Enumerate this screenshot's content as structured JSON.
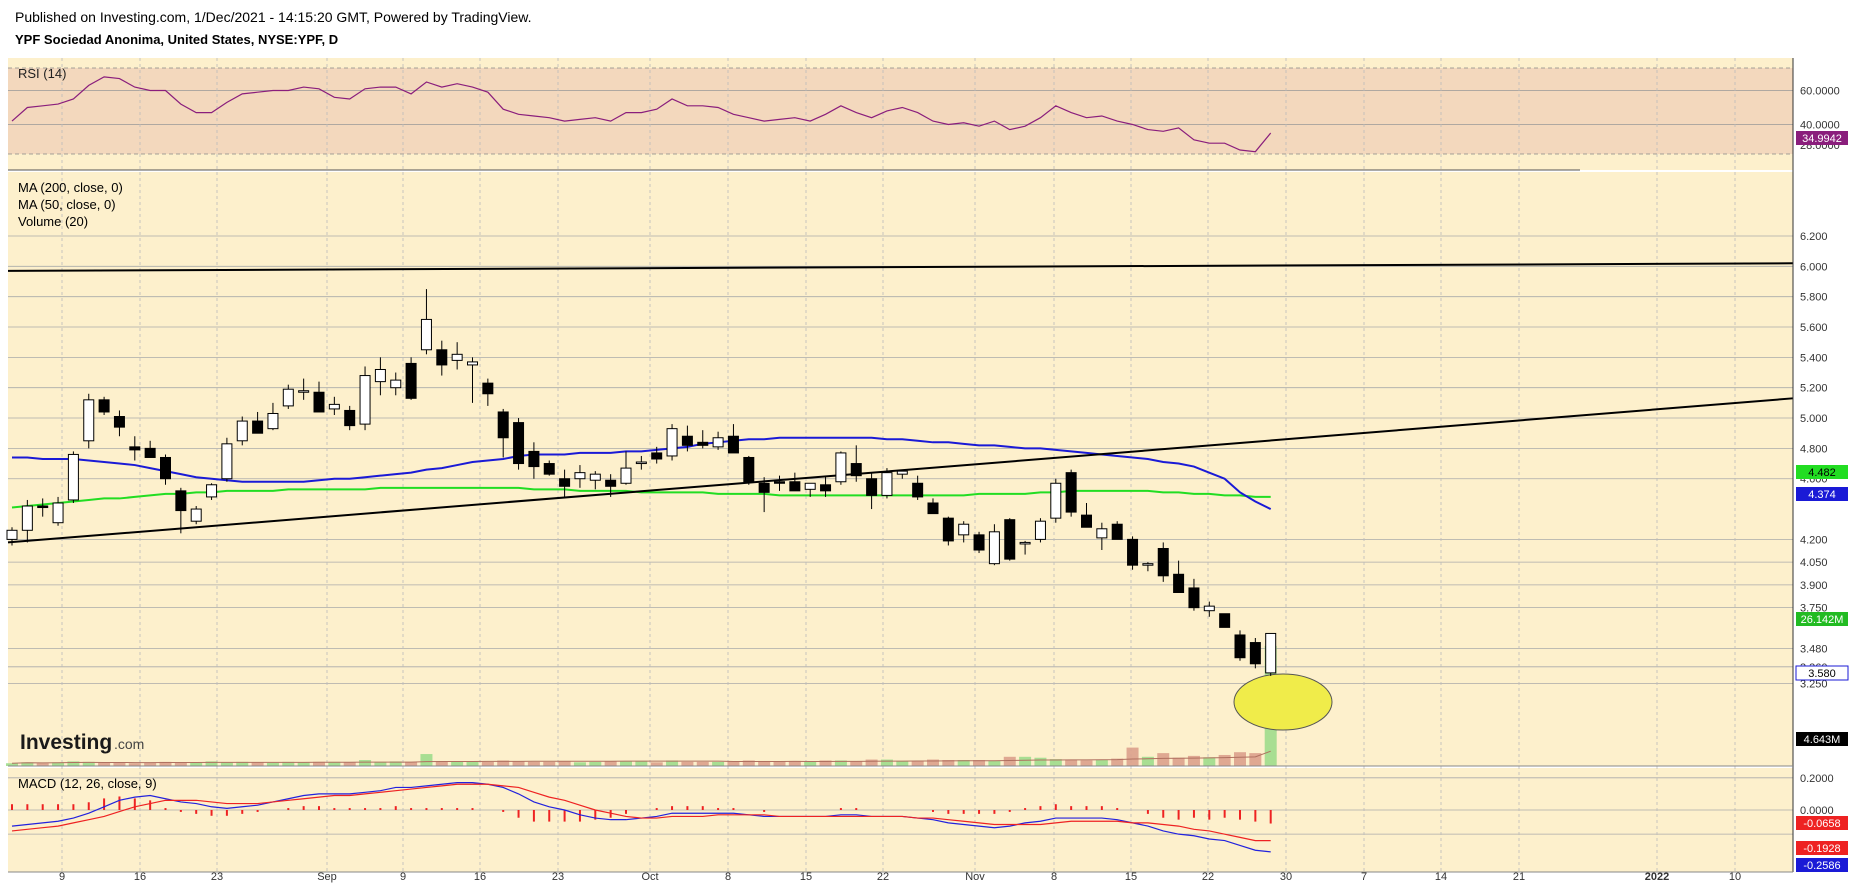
{
  "header": {
    "published": "Published on Investing.com, 1/Dec/2021 - 14:15:20 GMT, Powered by TradingView.",
    "symbol": "YPF Sociedad Anonima, United States, NYSE:YPF, D"
  },
  "colors": {
    "pane_bg": "#fdf0cc",
    "rsi_band": "#f3d8bd",
    "rsi_line": "#8a1e7c",
    "ma200": "#22dd22",
    "ma50": "#1a1ad6",
    "bull_vol": "#9fdc8c",
    "bear_vol": "#dca08c",
    "macd_line": "#2222dd",
    "signal_line": "#ee2222",
    "hist": "#ee2222",
    "highlight": "#f0ec4a"
  },
  "rsi_pane": {
    "label": "RSI (14)",
    "ticks": [
      "60.0000",
      "40.0000",
      "28.0000"
    ],
    "last_value": "34.9942"
  },
  "price_pane": {
    "legend": [
      "MA (200, close, 0)",
      "MA (50, close, 0)",
      "Volume (20)"
    ],
    "ticks": [
      "6.200",
      "6.000",
      "5.800",
      "5.600",
      "5.400",
      "5.200",
      "5.000",
      "4.800",
      "4.600",
      "4.200",
      "4.050",
      "3.900",
      "3.750",
      "3.480",
      "3.360",
      "3.250"
    ],
    "ma200_label": "4.482",
    "ma50_label": "4.374",
    "volume_label": "26.142M",
    "price_label": "3.580",
    "volume_ma_label": "4.643M",
    "watermark": "Investing",
    "watermark_suffix": ".com"
  },
  "macd_pane": {
    "label": "MACD (12, 26, close, 9)",
    "ticks": [
      "0.2000",
      "0.0000"
    ],
    "hist_label": "-0.0658",
    "signal_label": "-0.1928",
    "macd_label": "-0.2586"
  },
  "x_axis": {
    "labels": [
      "9",
      "16",
      "23",
      "Sep",
      "9",
      "16",
      "23",
      "Oct",
      "8",
      "15",
      "22",
      "Nov",
      "8",
      "15",
      "22",
      "30",
      "7",
      "14",
      "21",
      "2022",
      "10"
    ]
  },
  "chart_data": {
    "type": "candlestick",
    "title": "YPF Sociedad Anonima, United States, NYSE:YPF, D",
    "candles": [
      {
        "o": 4.2,
        "h": 4.28,
        "l": 4.16,
        "c": 4.26
      },
      {
        "o": 4.26,
        "h": 4.46,
        "l": 4.18,
        "c": 4.42
      },
      {
        "o": 4.42,
        "h": 4.47,
        "l": 4.35,
        "c": 4.41
      },
      {
        "o": 4.31,
        "h": 4.48,
        "l": 4.29,
        "c": 4.44
      },
      {
        "o": 4.46,
        "h": 4.78,
        "l": 4.44,
        "c": 4.76
      },
      {
        "o": 4.85,
        "h": 5.16,
        "l": 4.8,
        "c": 5.12
      },
      {
        "o": 5.12,
        "h": 5.14,
        "l": 5.02,
        "c": 5.04
      },
      {
        "o": 5.01,
        "h": 5.05,
        "l": 4.88,
        "c": 4.94
      },
      {
        "o": 4.81,
        "h": 4.88,
        "l": 4.72,
        "c": 4.79
      },
      {
        "o": 4.8,
        "h": 4.85,
        "l": 4.76,
        "c": 4.74
      },
      {
        "o": 4.74,
        "h": 4.76,
        "l": 4.56,
        "c": 4.6
      },
      {
        "o": 4.52,
        "h": 4.54,
        "l": 4.24,
        "c": 4.39
      },
      {
        "o": 4.32,
        "h": 4.42,
        "l": 4.3,
        "c": 4.4
      },
      {
        "o": 4.48,
        "h": 4.57,
        "l": 4.46,
        "c": 4.56
      },
      {
        "o": 4.6,
        "h": 4.87,
        "l": 4.58,
        "c": 4.83
      },
      {
        "o": 4.85,
        "h": 5.01,
        "l": 4.82,
        "c": 4.98
      },
      {
        "o": 4.98,
        "h": 5.04,
        "l": 4.9,
        "c": 4.9
      },
      {
        "o": 4.93,
        "h": 5.1,
        "l": 4.92,
        "c": 5.03
      },
      {
        "o": 5.08,
        "h": 5.22,
        "l": 5.06,
        "c": 5.19
      },
      {
        "o": 5.18,
        "h": 5.26,
        "l": 5.12,
        "c": 5.18
      },
      {
        "o": 5.17,
        "h": 5.24,
        "l": 5.04,
        "c": 5.04
      },
      {
        "o": 5.06,
        "h": 5.14,
        "l": 5.02,
        "c": 5.09
      },
      {
        "o": 5.05,
        "h": 5.08,
        "l": 4.92,
        "c": 4.95
      },
      {
        "o": 4.96,
        "h": 5.34,
        "l": 4.92,
        "c": 5.28
      },
      {
        "o": 5.24,
        "h": 5.4,
        "l": 5.15,
        "c": 5.32
      },
      {
        "o": 5.2,
        "h": 5.3,
        "l": 5.15,
        "c": 5.25
      },
      {
        "o": 5.36,
        "h": 5.4,
        "l": 5.12,
        "c": 5.13
      },
      {
        "o": 5.45,
        "h": 5.85,
        "l": 5.42,
        "c": 5.65
      },
      {
        "o": 5.45,
        "h": 5.51,
        "l": 5.28,
        "c": 5.35
      },
      {
        "o": 5.38,
        "h": 5.5,
        "l": 5.32,
        "c": 5.42
      },
      {
        "o": 5.35,
        "h": 5.4,
        "l": 5.1,
        "c": 5.37
      },
      {
        "o": 5.23,
        "h": 5.26,
        "l": 5.08,
        "c": 5.16
      },
      {
        "o": 5.04,
        "h": 5.06,
        "l": 4.74,
        "c": 4.87
      },
      {
        "o": 4.97,
        "h": 5.0,
        "l": 4.66,
        "c": 4.7
      },
      {
        "o": 4.78,
        "h": 4.84,
        "l": 4.6,
        "c": 4.68
      },
      {
        "o": 4.7,
        "h": 4.72,
        "l": 4.62,
        "c": 4.63
      },
      {
        "o": 4.6,
        "h": 4.66,
        "l": 4.47,
        "c": 4.55
      },
      {
        "o": 4.6,
        "h": 4.69,
        "l": 4.54,
        "c": 4.64
      },
      {
        "o": 4.59,
        "h": 4.65,
        "l": 4.53,
        "c": 4.63
      },
      {
        "o": 4.59,
        "h": 4.63,
        "l": 4.48,
        "c": 4.55
      },
      {
        "o": 4.57,
        "h": 4.78,
        "l": 4.56,
        "c": 4.67
      },
      {
        "o": 4.7,
        "h": 4.75,
        "l": 4.66,
        "c": 4.71
      },
      {
        "o": 4.77,
        "h": 4.81,
        "l": 4.7,
        "c": 4.73
      },
      {
        "o": 4.75,
        "h": 4.96,
        "l": 4.72,
        "c": 4.93
      },
      {
        "o": 4.88,
        "h": 4.95,
        "l": 4.78,
        "c": 4.82
      },
      {
        "o": 4.84,
        "h": 4.92,
        "l": 4.8,
        "c": 4.82
      },
      {
        "o": 4.81,
        "h": 4.91,
        "l": 4.79,
        "c": 4.87
      },
      {
        "o": 4.88,
        "h": 4.96,
        "l": 4.78,
        "c": 4.77
      },
      {
        "o": 4.74,
        "h": 4.75,
        "l": 4.56,
        "c": 4.58
      },
      {
        "o": 4.57,
        "h": 4.61,
        "l": 4.38,
        "c": 4.51
      },
      {
        "o": 4.58,
        "h": 4.62,
        "l": 4.52,
        "c": 4.57
      },
      {
        "o": 4.58,
        "h": 4.64,
        "l": 4.54,
        "c": 4.52
      },
      {
        "o": 4.53,
        "h": 4.56,
        "l": 4.48,
        "c": 4.57
      },
      {
        "o": 4.56,
        "h": 4.62,
        "l": 4.48,
        "c": 4.52
      },
      {
        "o": 4.58,
        "h": 4.78,
        "l": 4.56,
        "c": 4.77
      },
      {
        "o": 4.7,
        "h": 4.82,
        "l": 4.58,
        "c": 4.62
      },
      {
        "o": 4.6,
        "h": 4.64,
        "l": 4.4,
        "c": 4.49
      },
      {
        "o": 4.49,
        "h": 4.67,
        "l": 4.47,
        "c": 4.64
      },
      {
        "o": 4.63,
        "h": 4.66,
        "l": 4.6,
        "c": 4.65
      },
      {
        "o": 4.57,
        "h": 4.62,
        "l": 4.46,
        "c": 4.48
      },
      {
        "o": 4.44,
        "h": 4.47,
        "l": 4.38,
        "c": 4.37
      },
      {
        "o": 4.34,
        "h": 4.35,
        "l": 4.16,
        "c": 4.19
      },
      {
        "o": 4.23,
        "h": 4.32,
        "l": 4.18,
        "c": 4.3
      },
      {
        "o": 4.23,
        "h": 4.25,
        "l": 4.11,
        "c": 4.13
      },
      {
        "o": 4.04,
        "h": 4.3,
        "l": 4.03,
        "c": 4.25
      },
      {
        "o": 4.33,
        "h": 4.34,
        "l": 4.06,
        "c": 4.07
      },
      {
        "o": 4.17,
        "h": 4.19,
        "l": 4.1,
        "c": 4.18
      },
      {
        "o": 4.2,
        "h": 4.34,
        "l": 4.18,
        "c": 4.32
      },
      {
        "o": 4.34,
        "h": 4.6,
        "l": 4.31,
        "c": 4.57
      },
      {
        "o": 4.64,
        "h": 4.66,
        "l": 4.35,
        "c": 4.38
      },
      {
        "o": 4.36,
        "h": 4.44,
        "l": 4.3,
        "c": 4.28
      },
      {
        "o": 4.21,
        "h": 4.31,
        "l": 4.13,
        "c": 4.27
      },
      {
        "o": 4.3,
        "h": 4.32,
        "l": 4.2,
        "c": 4.2
      },
      {
        "o": 4.2,
        "h": 4.22,
        "l": 4.0,
        "c": 4.03
      },
      {
        "o": 4.03,
        "h": 4.05,
        "l": 3.99,
        "c": 4.04
      },
      {
        "o": 4.14,
        "h": 4.18,
        "l": 3.92,
        "c": 3.96
      },
      {
        "o": 3.97,
        "h": 4.06,
        "l": 3.85,
        "c": 3.85
      },
      {
        "o": 3.88,
        "h": 3.94,
        "l": 3.73,
        "c": 3.75
      },
      {
        "o": 3.73,
        "h": 3.79,
        "l": 3.69,
        "c": 3.76
      },
      {
        "o": 3.71,
        "h": 3.71,
        "l": 3.65,
        "c": 3.62
      },
      {
        "o": 3.57,
        "h": 3.6,
        "l": 3.4,
        "c": 3.42
      },
      {
        "o": 3.52,
        "h": 3.55,
        "l": 3.35,
        "c": 3.38
      },
      {
        "o": 3.32,
        "h": 3.58,
        "l": 3.3,
        "c": 3.58
      }
    ],
    "volume": [
      0.6,
      0.8,
      0.6,
      0.8,
      1.0,
      0.9,
      0.7,
      0.7,
      0.6,
      0.7,
      0.9,
      0.8,
      0.8,
      1.0,
      0.8,
      0.9,
      0.8,
      0.7,
      0.9,
      0.8,
      0.9,
      0.9,
      0.8,
      1.3,
      0.9,
      1.0,
      0.9,
      2.6,
      1.0,
      1.0,
      1.0,
      0.9,
      1.2,
      1.0,
      0.9,
      0.9,
      1.0,
      0.8,
      0.9,
      1.0,
      1.0,
      1.1,
      0.8,
      1.2,
      0.9,
      0.9,
      0.9,
      1.0,
      1.2,
      1.1,
      1.0,
      1.1,
      0.9,
      1.2,
      1.2,
      1.0,
      1.4,
      1.4,
      1.1,
      1.1,
      1.4,
      1.3,
      1.3,
      1.3,
      1.2,
      2.0,
      2.0,
      1.8,
      1.5,
      1.4,
      1.2,
      1.4,
      1.6,
      4.0,
      2.0,
      2.8,
      1.8,
      2.2,
      1.9,
      2.4,
      3.0,
      2.8,
      26.1
    ],
    "ma200": [
      4.41,
      4.42,
      4.43,
      4.44,
      4.45,
      4.46,
      4.47,
      4.47,
      4.48,
      4.49,
      4.5,
      4.5,
      4.51,
      4.51,
      4.52,
      4.52,
      4.52,
      4.52,
      4.53,
      4.53,
      4.53,
      4.53,
      4.53,
      4.53,
      4.54,
      4.54,
      4.54,
      4.54,
      4.54,
      4.54,
      4.54,
      4.54,
      4.54,
      4.54,
      4.53,
      4.53,
      4.53,
      4.52,
      4.52,
      4.52,
      4.52,
      4.51,
      4.51,
      4.51,
      4.51,
      4.51,
      4.5,
      4.5,
      4.5,
      4.5,
      4.49,
      4.49,
      4.49,
      4.49,
      4.49,
      4.49,
      4.49,
      4.49,
      4.49,
      4.49,
      4.49,
      4.49,
      4.49,
      4.5,
      4.5,
      4.5,
      4.5,
      4.51,
      4.51,
      4.52,
      4.52,
      4.52,
      4.52,
      4.52,
      4.52,
      4.51,
      4.51,
      4.5,
      4.5,
      4.49,
      4.49,
      4.48,
      4.48
    ],
    "ma50": [
      4.74,
      4.74,
      4.73,
      4.73,
      4.73,
      4.72,
      4.71,
      4.7,
      4.69,
      4.67,
      4.65,
      4.63,
      4.61,
      4.6,
      4.59,
      4.58,
      4.58,
      4.58,
      4.58,
      4.58,
      4.59,
      4.6,
      4.6,
      4.61,
      4.62,
      4.63,
      4.64,
      4.66,
      4.67,
      4.69,
      4.71,
      4.72,
      4.73,
      4.75,
      4.76,
      4.76,
      4.76,
      4.77,
      4.77,
      4.77,
      4.78,
      4.78,
      4.79,
      4.8,
      4.81,
      4.83,
      4.84,
      4.85,
      4.86,
      4.86,
      4.87,
      4.87,
      4.87,
      4.87,
      4.87,
      4.87,
      4.87,
      4.86,
      4.86,
      4.85,
      4.84,
      4.84,
      4.83,
      4.82,
      4.82,
      4.81,
      4.8,
      4.8,
      4.79,
      4.78,
      4.77,
      4.76,
      4.75,
      4.74,
      4.73,
      4.71,
      4.7,
      4.68,
      4.64,
      4.6,
      4.51,
      4.45,
      4.4
    ],
    "rsi": [
      42,
      50,
      51,
      52,
      55,
      63,
      68,
      67,
      62,
      60,
      60,
      52,
      47,
      47,
      53,
      58,
      59,
      60,
      60,
      62,
      61,
      56,
      55,
      61,
      62,
      62,
      58,
      65,
      62,
      64,
      62,
      59,
      49,
      46,
      45,
      44,
      42,
      43,
      44,
      42,
      47,
      47,
      49,
      55,
      51,
      51,
      50,
      46,
      44,
      42,
      43,
      44,
      42,
      46,
      51,
      47,
      44,
      48,
      50,
      47,
      42,
      40,
      41,
      39,
      42,
      37,
      39,
      44,
      51,
      47,
      44,
      45,
      42,
      40,
      37,
      36,
      38,
      31,
      29,
      29,
      25,
      24,
      35
    ],
    "macd": [
      -0.1,
      -0.09,
      -0.08,
      -0.07,
      -0.05,
      -0.02,
      0.02,
      0.06,
      0.08,
      0.09,
      0.07,
      0.05,
      0.04,
      0.02,
      0.01,
      0.02,
      0.03,
      0.05,
      0.07,
      0.09,
      0.1,
      0.1,
      0.1,
      0.11,
      0.12,
      0.14,
      0.14,
      0.15,
      0.16,
      0.17,
      0.17,
      0.16,
      0.14,
      0.1,
      0.05,
      0.02,
      0.0,
      -0.03,
      -0.05,
      -0.06,
      -0.06,
      -0.05,
      -0.04,
      -0.02,
      -0.02,
      -0.02,
      -0.02,
      -0.02,
      -0.03,
      -0.04,
      -0.04,
      -0.04,
      -0.04,
      -0.04,
      -0.03,
      -0.03,
      -0.04,
      -0.04,
      -0.04,
      -0.05,
      -0.06,
      -0.08,
      -0.09,
      -0.1,
      -0.11,
      -0.1,
      -0.08,
      -0.07,
      -0.05,
      -0.05,
      -0.05,
      -0.05,
      -0.06,
      -0.08,
      -0.1,
      -0.13,
      -0.15,
      -0.16,
      -0.18,
      -0.19,
      -0.22,
      -0.25,
      -0.26
    ],
    "signal": [
      -0.13,
      -0.12,
      -0.11,
      -0.1,
      -0.08,
      -0.06,
      -0.04,
      -0.01,
      0.02,
      0.04,
      0.06,
      0.06,
      0.06,
      0.05,
      0.04,
      0.04,
      0.04,
      0.05,
      0.06,
      0.07,
      0.08,
      0.09,
      0.09,
      0.1,
      0.11,
      0.12,
      0.13,
      0.14,
      0.15,
      0.16,
      0.16,
      0.16,
      0.15,
      0.14,
      0.11,
      0.08,
      0.06,
      0.03,
      0.0,
      -0.02,
      -0.04,
      -0.05,
      -0.05,
      -0.04,
      -0.04,
      -0.04,
      -0.03,
      -0.03,
      -0.03,
      -0.03,
      -0.04,
      -0.04,
      -0.04,
      -0.04,
      -0.04,
      -0.04,
      -0.04,
      -0.04,
      -0.04,
      -0.05,
      -0.05,
      -0.06,
      -0.07,
      -0.08,
      -0.09,
      -0.09,
      -0.09,
      -0.09,
      -0.08,
      -0.07,
      -0.07,
      -0.07,
      -0.07,
      -0.08,
      -0.08,
      -0.09,
      -0.1,
      -0.12,
      -0.13,
      -0.15,
      -0.17,
      -0.19,
      -0.19
    ],
    "ma200_trendline": {
      "start": 5.97,
      "end": 6.02
    },
    "support_trendline": {
      "start": 4.18,
      "end": 5.13
    },
    "rsi_ticks": [
      60,
      40,
      28
    ],
    "price_ticks": [
      6.2,
      6.0,
      5.8,
      5.6,
      5.4,
      5.2,
      5.0,
      4.8,
      4.6,
      4.2,
      4.05,
      3.9,
      3.75,
      3.48,
      3.36,
      3.25
    ],
    "macd_ticks": [
      0.2,
      0.0
    ],
    "grid": true
  }
}
